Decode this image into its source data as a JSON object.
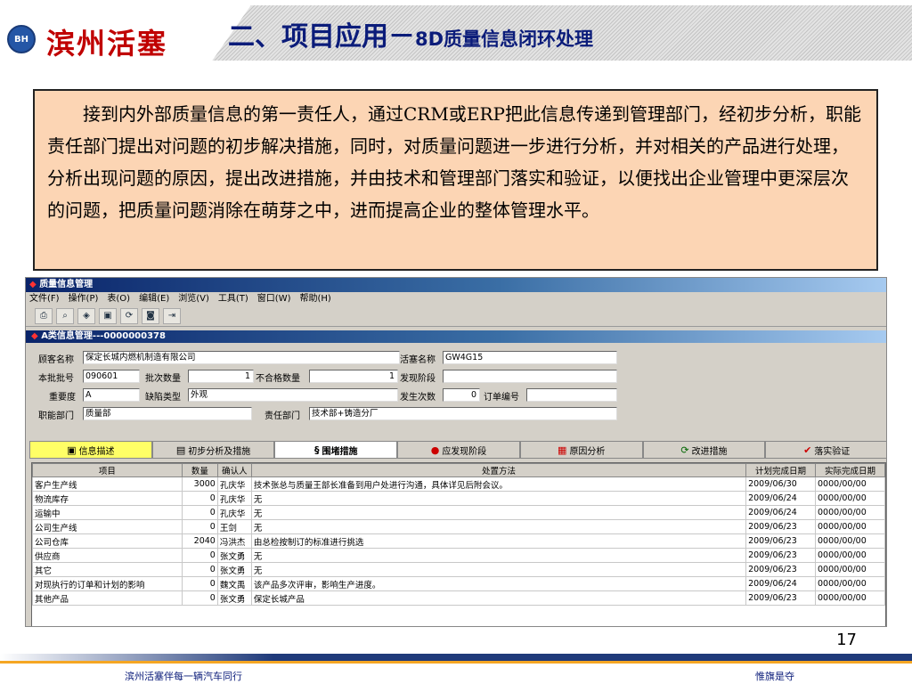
{
  "header": {
    "logo_badge": "BH",
    "logo_text": "滨州活塞",
    "title_main": "二、项目应用－",
    "title_sub": "8D质量信息闭环处理"
  },
  "textbox": {
    "paragraph": "接到内外部质量信息的第一责任人，通过CRM或ERP把此信息传递到管理部门，经初步分析，职能责任部门提出对问题的初步解决措施，同时，对质量问题进一步进行分析，并对相关的产品进行处理，分析出现问题的原因，提出改进措施，并由技术和管理部门落实和验证，以便找出企业管理中更深层次的问题，把质量问题消除在萌芽之中，进而提高企业的整体管理水平。"
  },
  "app": {
    "window_title": "质量信息管理",
    "menu": [
      "文件(F)",
      "操作(P)",
      "表(O)",
      "编辑(E)",
      "浏览(V)",
      "工具(T)",
      "窗口(W)",
      "帮助(H)"
    ],
    "toolbar_icons": [
      "print-icon",
      "preview-icon",
      "stamp-icon",
      "save-icon",
      "refresh-icon",
      "disk-icon",
      "exit-icon"
    ],
    "sub_window_title": "A类信息管理---0000000378",
    "form": {
      "customer_label": "顾客名称",
      "customer_value": "保定长城内燃机制造有限公司",
      "piston_label": "活塞名称",
      "piston_value": "GW4G15",
      "batch_no_label": "本批批号",
      "batch_no_value": "090601",
      "batch_qty_label": "批次数量",
      "batch_qty_value": "1",
      "nonconform_label": "不合格数量",
      "nonconform_value": "1",
      "found_stage_label": "发现阶段",
      "found_stage_value": "",
      "severity_label": "重要度",
      "severity_value": "A",
      "defect_type_label": "缺陷类型",
      "defect_type_value": "外观",
      "occur_count_label": "发生次数",
      "occur_count_value": "0",
      "order_no_label": "订单编号",
      "order_no_value": "",
      "dept_label": "职能部门",
      "dept_value": "质量部",
      "resp_dept_label": "责任部门",
      "resp_dept_value": "技术部+铸造分厂"
    },
    "tabs": [
      {
        "label": "信息描述",
        "icon": "▣"
      },
      {
        "label": "初步分析及措施",
        "icon": "▤"
      },
      {
        "label": "围堵措施",
        "icon": "§"
      },
      {
        "label": "应发现阶段",
        "icon": "●"
      },
      {
        "label": "原因分析",
        "icon": "▦"
      },
      {
        "label": "改进措施",
        "icon": "⟳"
      },
      {
        "label": "落实验证",
        "icon": "✔"
      }
    ],
    "grid": {
      "columns": [
        "项目",
        "数量",
        "确认人",
        "处置方法",
        "计划完成日期",
        "实际完成日期"
      ],
      "rows": [
        [
          "客户生产线",
          "3000",
          "孔庆华",
          "技术张总与质量王部长准备到用户处进行沟通，具体详见后附会议。",
          "2009/06/30",
          "0000/00/00"
        ],
        [
          "物流库存",
          "0",
          "孔庆华",
          "无",
          "2009/06/24",
          "0000/00/00"
        ],
        [
          "运输中",
          "0",
          "孔庆华",
          "无",
          "2009/06/24",
          "0000/00/00"
        ],
        [
          "公司生产线",
          "0",
          "王剑",
          "无",
          "2009/06/23",
          "0000/00/00"
        ],
        [
          "公司仓库",
          "2040",
          "冯洪杰",
          "由总检按制订的标准进行挑选",
          "2009/06/23",
          "0000/00/00"
        ],
        [
          "供应商",
          "0",
          "张文勇",
          "无",
          "2009/06/23",
          "0000/00/00"
        ],
        [
          "其它",
          "0",
          "张文勇",
          "无",
          "2009/06/23",
          "0000/00/00"
        ],
        [
          "对现执行的订单和计划的影响",
          "0",
          "魏文禹",
          "该产品多次评审，影响生产进度。",
          "2009/06/24",
          "0000/00/00"
        ],
        [
          "其他产品",
          "0",
          "张文勇",
          "保定长城产品",
          "2009/06/23",
          "0000/00/00"
        ]
      ]
    }
  },
  "footer": {
    "page_number": "17",
    "left_text": "滨州活塞伴每一辆汽车同行",
    "right_text": "惟旗是夺"
  }
}
